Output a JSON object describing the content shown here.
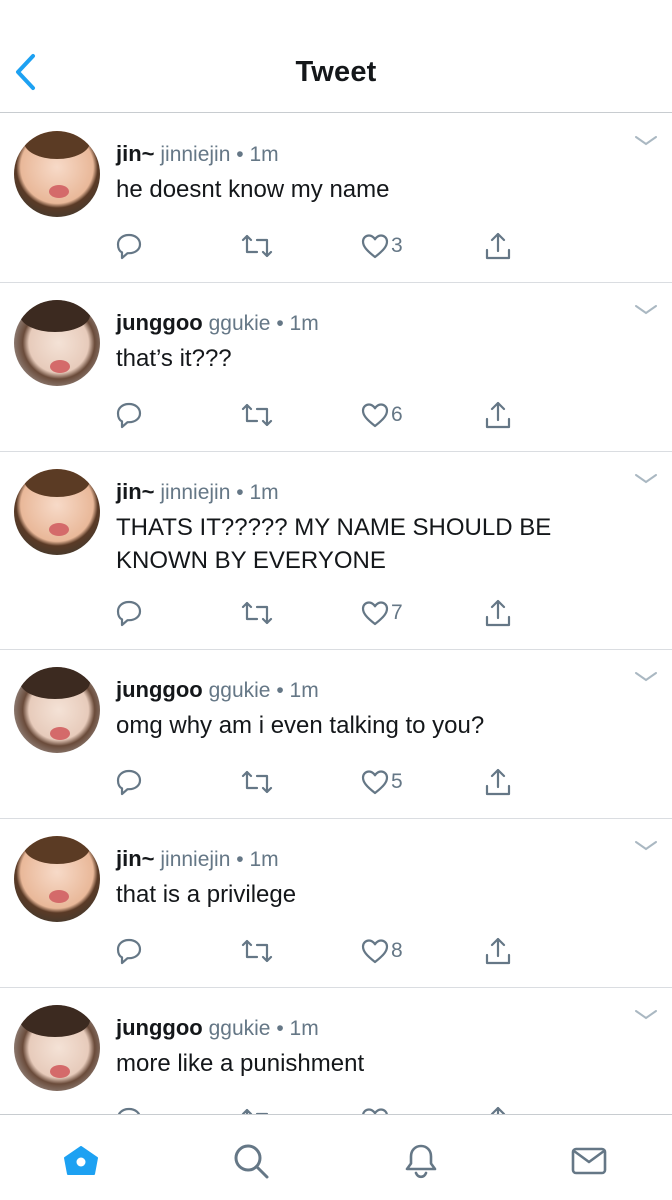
{
  "header": {
    "title": "Tweet",
    "back_icon": "chevron-left-icon",
    "accent": "#1da1f2"
  },
  "tweets": [
    {
      "name": "jin~",
      "handle": "jinniejin",
      "dot": "•",
      "time": "1m",
      "avatar": "jin",
      "text": "he doesnt know my name",
      "likes": "3"
    },
    {
      "name": "junggoo",
      "handle": "ggukie",
      "dot": "•",
      "time": "1m",
      "avatar": "jung",
      "text": "that’s it???",
      "likes": "6"
    },
    {
      "name": "jin~",
      "handle": "jinniejin",
      "dot": "•",
      "time": "1m",
      "avatar": "jin",
      "text": "THATS IT????? MY NAME SHOULD BE KNOWN BY EVERYONE",
      "likes": "7"
    },
    {
      "name": "junggoo",
      "handle": "ggukie",
      "dot": "•",
      "time": "1m",
      "avatar": "jung",
      "text": "omg why am i even talking to you?",
      "likes": "5"
    },
    {
      "name": "jin~",
      "handle": "jinniejin",
      "dot": "•",
      "time": "1m",
      "avatar": "jin",
      "text": "that is a privilege",
      "likes": "8"
    },
    {
      "name": "junggoo",
      "handle": "ggukie",
      "dot": "•",
      "time": "1m",
      "avatar": "jung",
      "text": "more like a punishment",
      "likes": ""
    }
  ],
  "action_icons": [
    "reply-icon",
    "retweet-icon",
    "like-icon",
    "share-icon"
  ],
  "tabbar": {
    "items": [
      "home-icon",
      "search-icon",
      "notifications-icon",
      "messages-icon"
    ],
    "active": "home-icon",
    "active_color": "#1da1f2"
  }
}
